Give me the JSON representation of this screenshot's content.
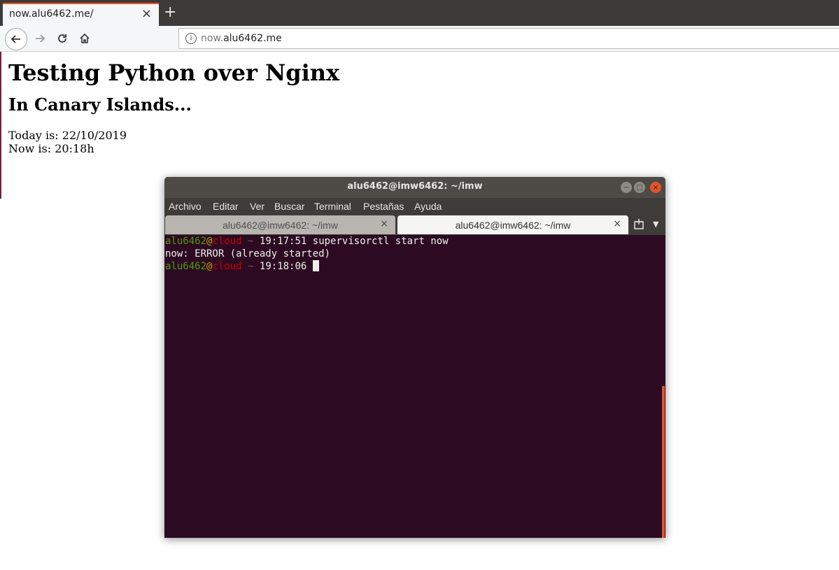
{
  "browser": {
    "tab_title": "now.alu6462.me/",
    "tab_close": "×",
    "new_tab": "+",
    "url_prefix": "now.",
    "url_domain": "alu6462.me"
  },
  "page": {
    "title": "Testing Python over Nginx",
    "subtitle": "In Canary Islands...",
    "date_line": "Today is: 22/10/2019",
    "time_line": "Now is: 20:18h"
  },
  "terminal": {
    "title": "alu6462@imw6462: ~/imw",
    "menu": [
      "Archivo",
      "Editar",
      "Ver",
      "Buscar",
      "Terminal",
      "Pestañas",
      "Ayuda"
    ],
    "tabs": [
      {
        "label": "alu6462@imw6462: ~/imw"
      },
      {
        "label": "alu6462@imw6462: ~/imw"
      }
    ],
    "lines": [
      {
        "user": "alu6462",
        "at": "@",
        "host": "cloud",
        "tilde": " ~ ",
        "time": "19:17:51",
        "command": " supervisorctl start now"
      },
      {
        "output": "now: ERROR (already started)"
      },
      {
        "user": "alu6462",
        "at": "@",
        "host": "cloud",
        "tilde": " ~ ",
        "time": "19:18:06",
        "command": " "
      }
    ]
  },
  "colors": {
    "accent": "#e9542e",
    "terminal_bg": "#2c0b22",
    "prompt_user": "#4e9a06",
    "prompt_host": "#cc0000"
  }
}
